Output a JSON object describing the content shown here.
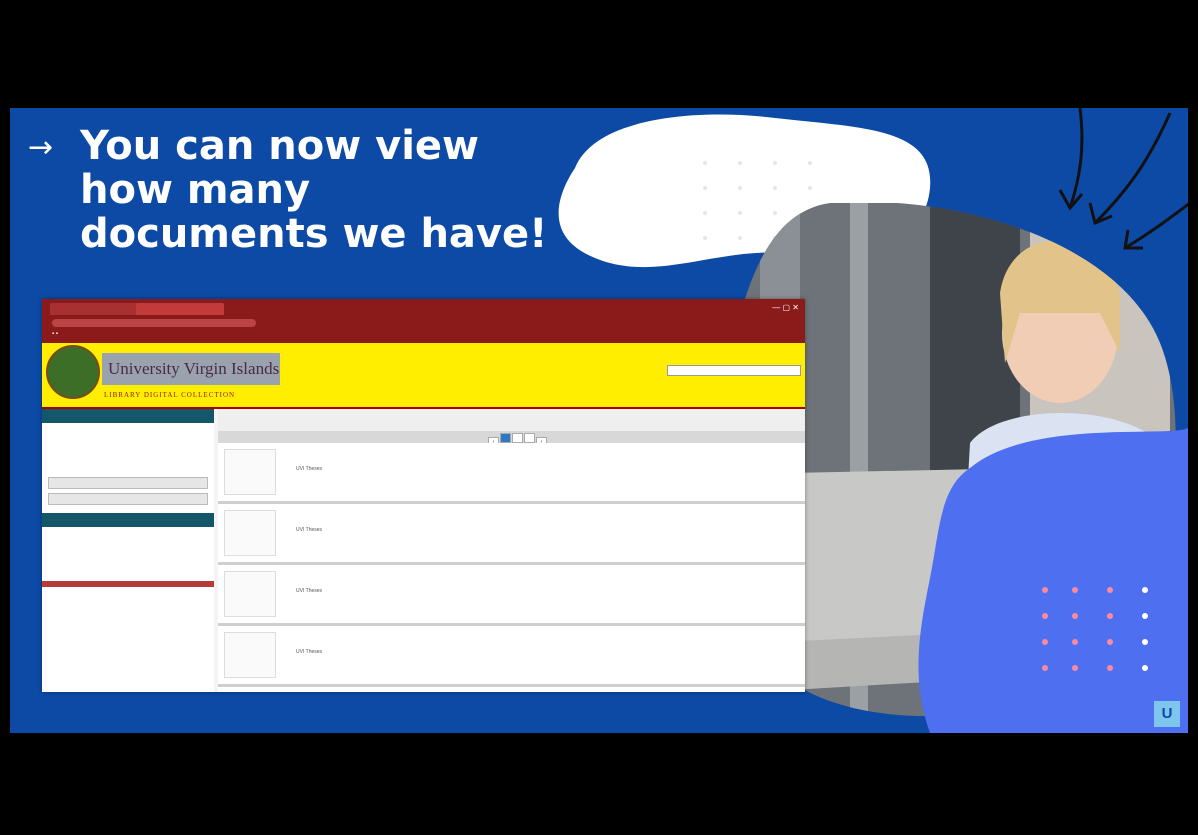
{
  "slide": {
    "headline": "You can now view how many documents we have!",
    "arrow_icon": "arrow-right-icon",
    "brand_color": "#0c4aa6",
    "accent_blob_color": "#4d6ff0"
  },
  "browser": {
    "header_bg": "#ffee00",
    "chrome_bg": "#8b1a1a",
    "site": {
      "title": "University Virgin Islands",
      "subtitle": "LIBRARY DIGITAL COLLECTION"
    },
    "records": [
      {
        "author": "UVI Theses"
      },
      {
        "author": "UVI Theses"
      },
      {
        "author": "UVI Theses"
      },
      {
        "author": "UVI Theses"
      }
    ]
  }
}
